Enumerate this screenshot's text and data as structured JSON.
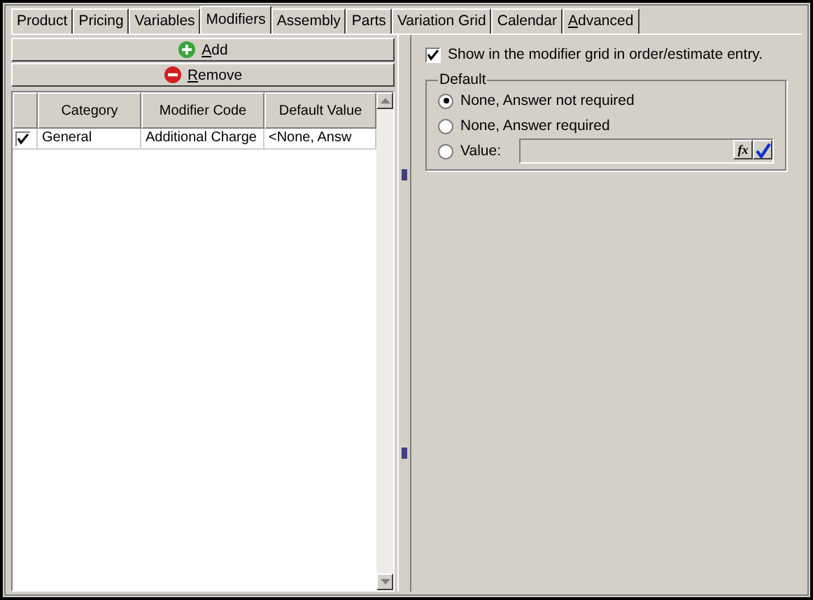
{
  "tabs": [
    {
      "label": "Product",
      "selected": false,
      "access_key": false
    },
    {
      "label": "Pricing",
      "selected": false,
      "access_key": false
    },
    {
      "label": "Variables",
      "selected": false,
      "access_key": false
    },
    {
      "label": "Modifiers",
      "selected": true,
      "access_key": false
    },
    {
      "label": "Assembly",
      "selected": false,
      "access_key": false
    },
    {
      "label": "Parts",
      "selected": false,
      "access_key": false
    },
    {
      "label": "Variation Grid",
      "selected": false,
      "access_key": false
    },
    {
      "label": "Calendar",
      "selected": false,
      "access_key": false
    },
    {
      "label": "Advanced",
      "selected": false,
      "access_key": true
    }
  ],
  "buttons": [
    {
      "kind": "add",
      "label": "Add",
      "access_key": true
    },
    {
      "kind": "remove",
      "label": "Remove",
      "access_key": true
    }
  ],
  "grid": {
    "columns": [
      "Category",
      "Modifier Code",
      "Default Value"
    ],
    "rows": [
      {
        "checked": true,
        "cells": [
          "General",
          "Additional Charge",
          "<None, Answ"
        ]
      }
    ]
  },
  "show_in_grid": {
    "label": "Show in the modifier grid in order/estimate entry.",
    "checked": true
  },
  "default_group": {
    "title": "Default",
    "options": [
      {
        "label": "None, Answer not required",
        "selected": true,
        "has_field": false
      },
      {
        "label": "None, Answer required",
        "selected": false,
        "has_field": false
      },
      {
        "label": "Value:",
        "selected": false,
        "has_field": true
      }
    ]
  },
  "formula_button": "fx"
}
